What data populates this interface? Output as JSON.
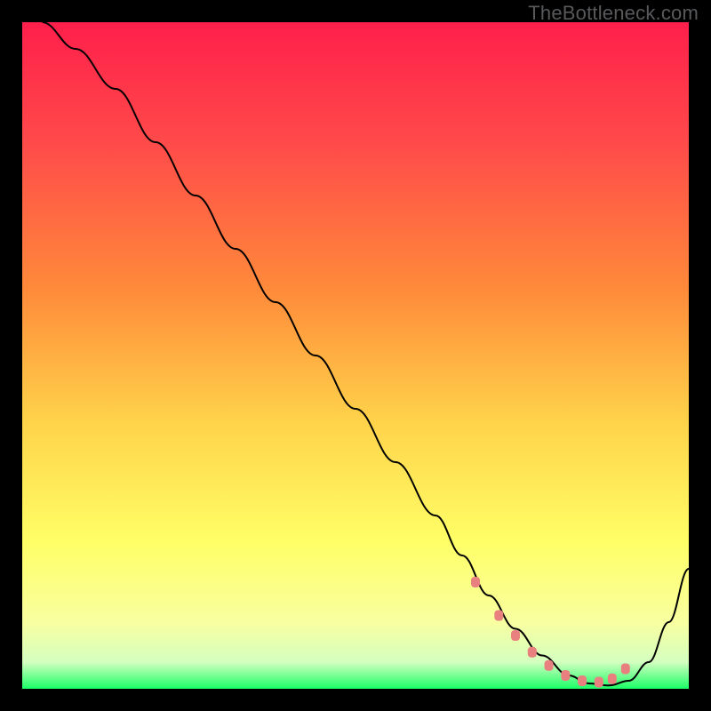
{
  "watermark": "TheBottleneck.com",
  "chart_data": {
    "type": "line",
    "title": "",
    "xlabel": "",
    "ylabel": "",
    "xlim": [
      0,
      100
    ],
    "ylim": [
      0,
      100
    ],
    "series": [
      {
        "name": "bottleneck-curve",
        "x": [
          3,
          8,
          14,
          20,
          26,
          32,
          38,
          44,
          50,
          56,
          62,
          66,
          70,
          74,
          78,
          82,
          85,
          88,
          91,
          94,
          97,
          100
        ],
        "y": [
          100,
          96,
          90,
          82,
          74,
          66,
          58,
          50,
          42,
          34,
          26,
          20,
          14,
          9,
          5,
          2,
          0.8,
          0.5,
          1.2,
          4,
          10,
          18
        ]
      }
    ],
    "highlight_points": {
      "name": "sweet-spot",
      "x": [
        68,
        71.5,
        74,
        76.5,
        79,
        81.5,
        84,
        86.5,
        88.5,
        90.5
      ],
      "y": [
        16,
        11,
        8,
        5.5,
        3.5,
        2,
        1.2,
        1,
        1.5,
        3
      ]
    },
    "colors": {
      "curve": "#000000",
      "dots": "#e98080",
      "gradient_top": "#ff1f4b",
      "gradient_bottom": "#1aff66"
    }
  }
}
